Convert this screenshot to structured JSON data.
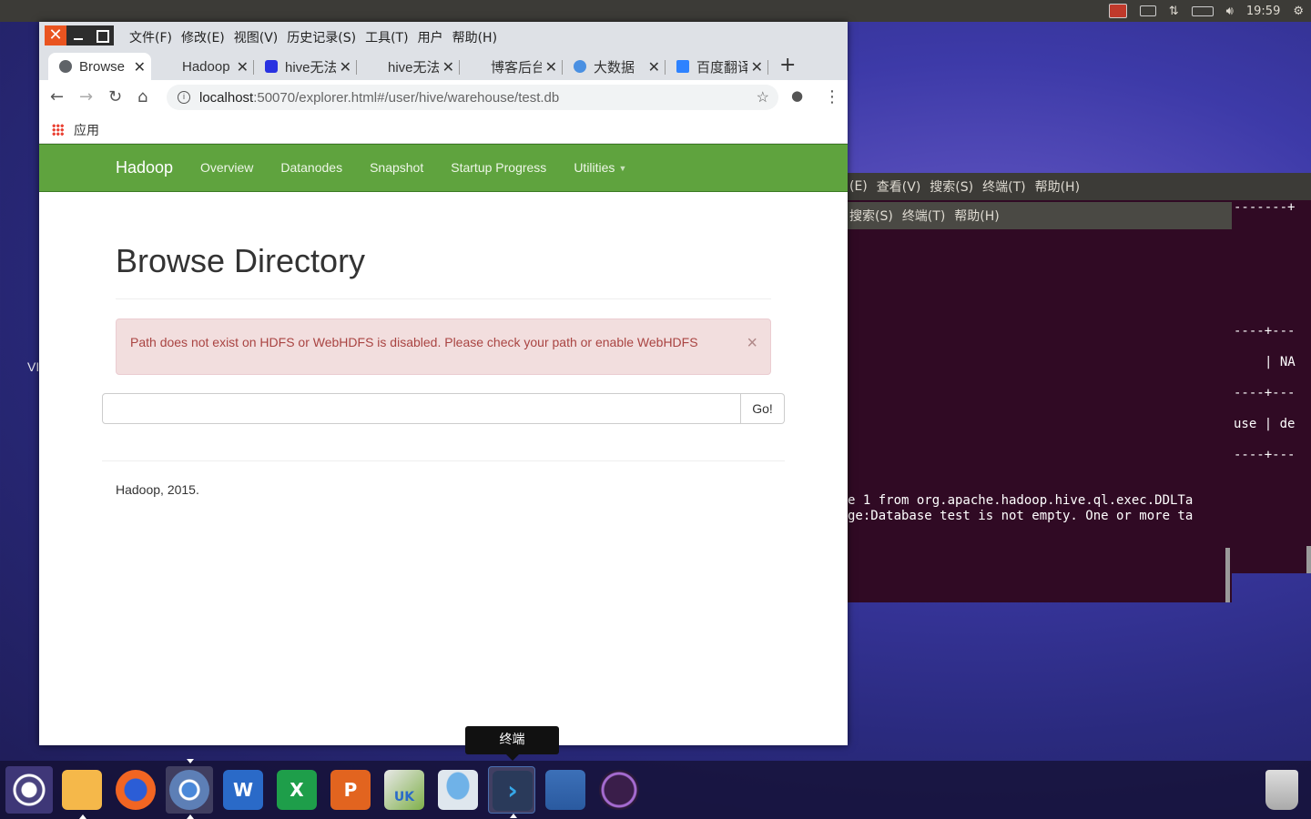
{
  "top_panel": {
    "clock": "19:59",
    "icons": [
      "record-icon",
      "keyboard-icon",
      "network-icon",
      "battery-icon",
      "volume-icon",
      "settings-gear-icon"
    ]
  },
  "left_fragment": "VI",
  "terminal_back": {
    "menu": [
      "(E)",
      "查看(V)",
      "搜索(S)",
      "终端(T)",
      "帮助(H)"
    ],
    "lines": [
      "-------+",
      "----+---",
      "| NA",
      "----+---",
      "use | de",
      "----+---"
    ]
  },
  "terminal_front": {
    "menu": [
      "搜索(S)",
      "终端(T)",
      "帮助(H)"
    ],
    "lines": [
      "e 1 from org.apache.hadoop.hive.ql.exec.DDLTa",
      "ge:Database test is not empty. One or more ta"
    ]
  },
  "browser": {
    "menu": [
      "文件(F)",
      "修改(E)",
      "视图(V)",
      "历史记录(S)",
      "工具(T)",
      "用户",
      "帮助(H)"
    ],
    "tabs": [
      {
        "label": "Browse",
        "icon_color": "#5f6368"
      },
      {
        "label": "Hadoop",
        "icon_color": "#dee1e6"
      },
      {
        "label": "hive无法",
        "icon_color": "#2932e1"
      },
      {
        "label": "hive无法",
        "icon_color": "#dee1e6"
      },
      {
        "label": "博客后台",
        "icon_color": "#dee1e6"
      },
      {
        "label": "大数据",
        "icon_color": "#4a90e2"
      },
      {
        "label": "百度翻译",
        "icon_color": "#2e82ff"
      }
    ],
    "url_host": "localhost",
    "url_path": ":50070/explorer.html#/user/hive/warehouse/test.db",
    "bookmarks_label": "应用"
  },
  "page": {
    "brand": "Hadoop",
    "nav": [
      "Overview",
      "Datanodes",
      "Snapshot",
      "Startup Progress",
      "Utilities"
    ],
    "title": "Browse Directory",
    "alert": "Path does not exist on HDFS or WebHDFS is disabled. Please check your path or enable WebHDFS",
    "search_value": "",
    "go_label": "Go!",
    "footer": "Hadoop, 2015."
  },
  "tooltip": "终端",
  "dock": {
    "apps": [
      "ubuntu-logo",
      "files",
      "firefox",
      "chromium",
      "wps-writer",
      "wps-spreadsheets",
      "wps-presentation",
      "ubuntu-kylin-store",
      "screenshot-tool",
      "terminal",
      "workspace-switcher",
      "disk-burner",
      "trash"
    ]
  },
  "colors": {
    "hadoop_green": "#5fa33e",
    "alert_bg": "#f2dede",
    "alert_text": "#a94442",
    "terminal_bg": "#300a24",
    "close_orange": "#e95420"
  }
}
